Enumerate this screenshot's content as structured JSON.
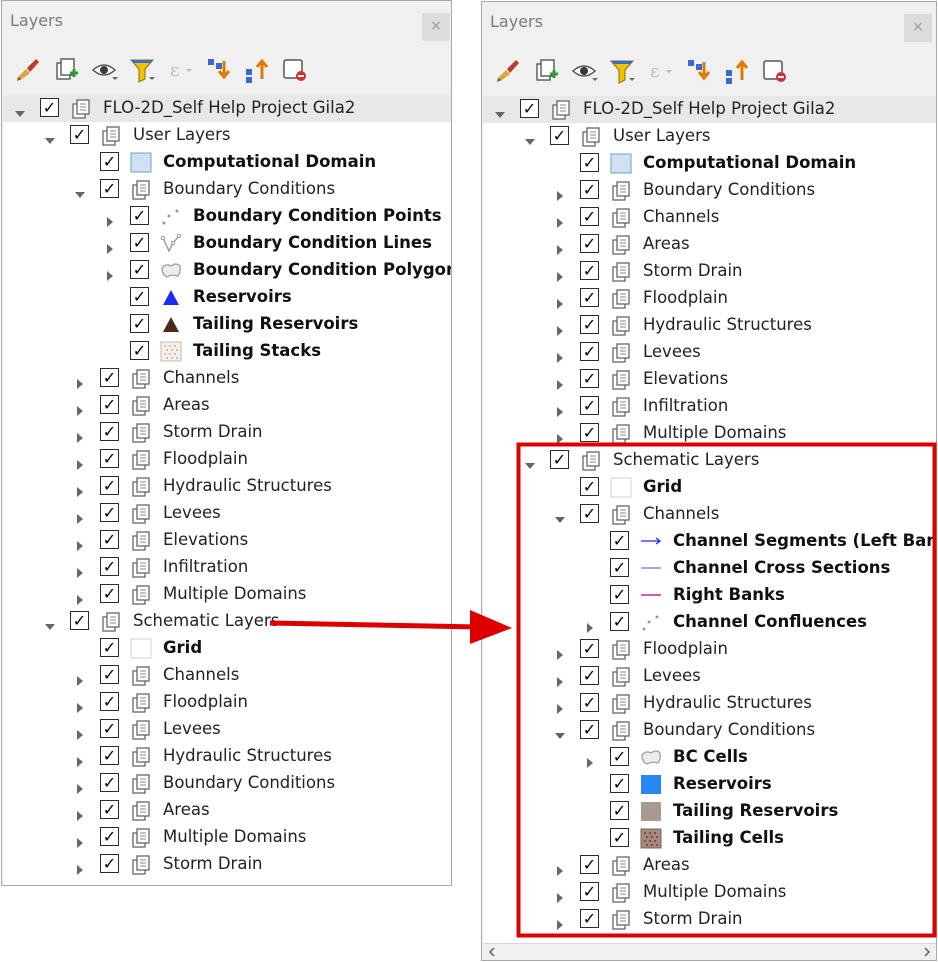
{
  "colors": {
    "highlight": "#dd0000",
    "arrow": "#dd0000",
    "panel_bg": "#f0f0f0",
    "tree_bg": "#ffffff"
  },
  "toolbar_icons": [
    "style-brush-icon",
    "add-group-icon",
    "eye-icon",
    "filter-icon",
    "expression-icon",
    "expand-all-icon",
    "collapse-all-icon",
    "remove-layer-icon"
  ],
  "left": {
    "title": "Layers",
    "close": "×",
    "rows": [
      {
        "level": 0,
        "exp": "open",
        "label": "FLO-2D_Self Help Project Gila2",
        "icon": "group",
        "bold": false
      },
      {
        "level": 1,
        "exp": "open",
        "label": "User Layers",
        "icon": "group",
        "bold": false
      },
      {
        "level": 2,
        "exp": "none",
        "label": "Computational Domain",
        "icon": "fill-lightblue",
        "bold": true
      },
      {
        "level": 2,
        "exp": "open",
        "label": "Boundary Conditions",
        "icon": "group",
        "bold": false
      },
      {
        "level": 3,
        "exp": "closed",
        "label": "Boundary Condition Points",
        "icon": "points",
        "bold": true
      },
      {
        "level": 3,
        "exp": "closed",
        "label": "Boundary Condition Lines",
        "icon": "lines",
        "bold": true
      },
      {
        "level": 3,
        "exp": "closed",
        "label": "Boundary Condition Polygons",
        "icon": "polygon",
        "bold": true
      },
      {
        "level": 3,
        "exp": "none",
        "label": "Reservoirs",
        "icon": "triangle-blue",
        "bold": true
      },
      {
        "level": 3,
        "exp": "none",
        "label": "Tailing Reservoirs",
        "icon": "triangle-brown",
        "bold": true
      },
      {
        "level": 3,
        "exp": "none",
        "label": "Tailing Stacks",
        "icon": "dots-fill",
        "bold": true
      },
      {
        "level": 2,
        "exp": "closed",
        "label": "Channels",
        "icon": "group",
        "bold": false
      },
      {
        "level": 2,
        "exp": "closed",
        "label": "Areas",
        "icon": "group",
        "bold": false
      },
      {
        "level": 2,
        "exp": "closed",
        "label": "Storm Drain",
        "icon": "group",
        "bold": false
      },
      {
        "level": 2,
        "exp": "closed",
        "label": "Floodplain",
        "icon": "group",
        "bold": false
      },
      {
        "level": 2,
        "exp": "closed",
        "label": "Hydraulic Structures",
        "icon": "group",
        "bold": false
      },
      {
        "level": 2,
        "exp": "closed",
        "label": "Levees",
        "icon": "group",
        "bold": false
      },
      {
        "level": 2,
        "exp": "closed",
        "label": "Elevations",
        "icon": "group",
        "bold": false
      },
      {
        "level": 2,
        "exp": "closed",
        "label": "Infiltration",
        "icon": "group",
        "bold": false
      },
      {
        "level": 2,
        "exp": "closed",
        "label": "Multiple Domains",
        "icon": "group",
        "bold": false
      },
      {
        "level": 1,
        "exp": "open",
        "label": "Schematic Layers",
        "icon": "group",
        "bold": false
      },
      {
        "level": 2,
        "exp": "none",
        "label": "Grid",
        "icon": "fill-white",
        "bold": true
      },
      {
        "level": 2,
        "exp": "closed",
        "label": "Channels",
        "icon": "group",
        "bold": false
      },
      {
        "level": 2,
        "exp": "closed",
        "label": "Floodplain",
        "icon": "group",
        "bold": false
      },
      {
        "level": 2,
        "exp": "closed",
        "label": "Levees",
        "icon": "group",
        "bold": false
      },
      {
        "level": 2,
        "exp": "closed",
        "label": "Hydraulic Structures",
        "icon": "group",
        "bold": false
      },
      {
        "level": 2,
        "exp": "closed",
        "label": "Boundary Conditions",
        "icon": "group",
        "bold": false
      },
      {
        "level": 2,
        "exp": "closed",
        "label": "Areas",
        "icon": "group",
        "bold": false
      },
      {
        "level": 2,
        "exp": "closed",
        "label": "Multiple Domains",
        "icon": "group",
        "bold": false
      },
      {
        "level": 2,
        "exp": "closed",
        "label": "Storm Drain",
        "icon": "group",
        "bold": false
      }
    ]
  },
  "right": {
    "title": "Layers",
    "close": "×",
    "rows": [
      {
        "level": 0,
        "exp": "open",
        "label": "FLO-2D_Self Help Project Gila2",
        "icon": "group",
        "bold": false
      },
      {
        "level": 1,
        "exp": "open",
        "label": "User Layers",
        "icon": "group",
        "bold": false
      },
      {
        "level": 2,
        "exp": "none",
        "label": "Computational Domain",
        "icon": "fill-lightblue",
        "bold": true
      },
      {
        "level": 2,
        "exp": "closed",
        "label": "Boundary Conditions",
        "icon": "group",
        "bold": false
      },
      {
        "level": 2,
        "exp": "closed",
        "label": "Channels",
        "icon": "group",
        "bold": false
      },
      {
        "level": 2,
        "exp": "closed",
        "label": "Areas",
        "icon": "group",
        "bold": false
      },
      {
        "level": 2,
        "exp": "closed",
        "label": "Storm Drain",
        "icon": "group",
        "bold": false
      },
      {
        "level": 2,
        "exp": "closed",
        "label": "Floodplain",
        "icon": "group",
        "bold": false
      },
      {
        "level": 2,
        "exp": "closed",
        "label": "Hydraulic Structures",
        "icon": "group",
        "bold": false
      },
      {
        "level": 2,
        "exp": "closed",
        "label": "Levees",
        "icon": "group",
        "bold": false
      },
      {
        "level": 2,
        "exp": "closed",
        "label": "Elevations",
        "icon": "group",
        "bold": false
      },
      {
        "level": 2,
        "exp": "closed",
        "label": "Infiltration",
        "icon": "group",
        "bold": false
      },
      {
        "level": 2,
        "exp": "closed",
        "label": "Multiple Domains",
        "icon": "group",
        "bold": false
      },
      {
        "level": 1,
        "exp": "open",
        "label": "Schematic Layers",
        "icon": "group",
        "bold": false
      },
      {
        "level": 2,
        "exp": "none",
        "label": "Grid",
        "icon": "fill-white",
        "bold": true
      },
      {
        "level": 2,
        "exp": "open",
        "label": "Channels",
        "icon": "group",
        "bold": false
      },
      {
        "level": 3,
        "exp": "none",
        "label": "Channel Segments (Left Banks)",
        "icon": "arrow-line-blue",
        "bold": true
      },
      {
        "level": 3,
        "exp": "none",
        "label": "Channel Cross Sections",
        "icon": "line-blue",
        "bold": true
      },
      {
        "level": 3,
        "exp": "none",
        "label": "Right Banks",
        "icon": "line-purple",
        "bold": true
      },
      {
        "level": 3,
        "exp": "closed",
        "label": "Channel Confluences",
        "icon": "points",
        "bold": true
      },
      {
        "level": 2,
        "exp": "closed",
        "label": "Floodplain",
        "icon": "group",
        "bold": false
      },
      {
        "level": 2,
        "exp": "closed",
        "label": "Levees",
        "icon": "group",
        "bold": false
      },
      {
        "level": 2,
        "exp": "closed",
        "label": "Hydraulic Structures",
        "icon": "group",
        "bold": false
      },
      {
        "level": 2,
        "exp": "open",
        "label": "Boundary Conditions",
        "icon": "group",
        "bold": false
      },
      {
        "level": 3,
        "exp": "closed",
        "label": "BC Cells",
        "icon": "polygon",
        "bold": true
      },
      {
        "level": 3,
        "exp": "none",
        "label": "Reservoirs",
        "icon": "fill-blue",
        "bold": true
      },
      {
        "level": 3,
        "exp": "none",
        "label": "Tailing Reservoirs",
        "icon": "fill-taupe",
        "bold": true
      },
      {
        "level": 3,
        "exp": "none",
        "label": "Tailing Cells",
        "icon": "dots-fill-brown",
        "bold": true
      },
      {
        "level": 2,
        "exp": "closed",
        "label": "Areas",
        "icon": "group",
        "bold": false
      },
      {
        "level": 2,
        "exp": "closed",
        "label": "Multiple Domains",
        "icon": "group",
        "bold": false
      },
      {
        "level": 2,
        "exp": "closed",
        "label": "Storm Drain",
        "icon": "group",
        "bold": false
      }
    ]
  }
}
